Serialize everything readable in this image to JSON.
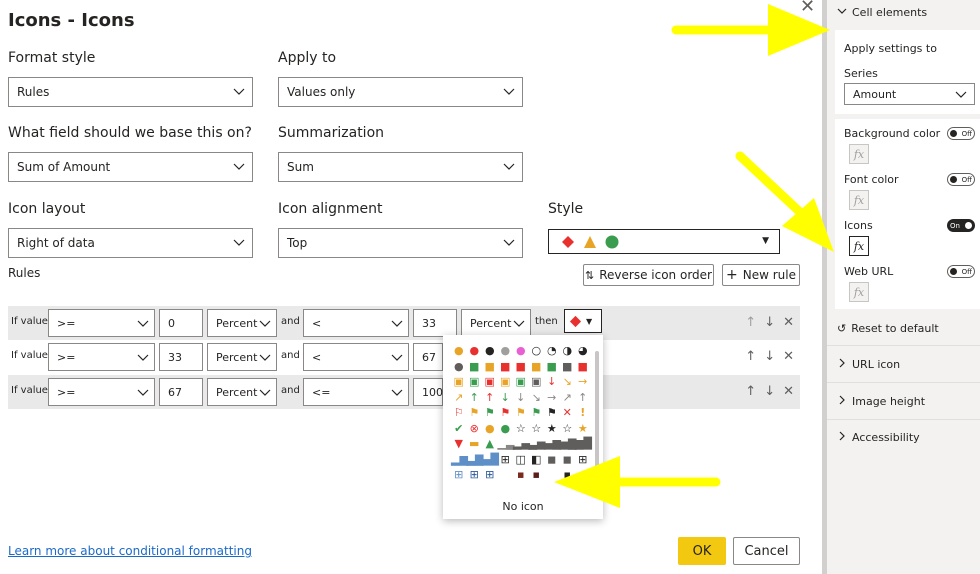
{
  "dialog": {
    "title": "Icons - Icons",
    "format_style_label": "Format style",
    "format_style_value": "Rules",
    "apply_to_label": "Apply to",
    "apply_to_value": "Values only",
    "base_field_label": "What field should we base this on?",
    "base_field_value": "Sum of Amount",
    "summarization_label": "Summarization",
    "summarization_value": "Sum",
    "icon_layout_label": "Icon layout",
    "icon_layout_value": "Right of data",
    "icon_alignment_label": "Icon alignment",
    "icon_alignment_value": "Top",
    "style_label": "Style",
    "rules_label": "Rules",
    "reverse_label": "Reverse icon order",
    "new_rule_label": "New rule",
    "learn_more": "Learn more about conditional formatting",
    "ok_label": "OK",
    "cancel_label": "Cancel"
  },
  "rules": [
    {
      "if": "If value",
      "op1": ">=",
      "v1": "0",
      "u1": "Percent",
      "and": "and",
      "op2": "<",
      "v2": "33",
      "u2": "Percent",
      "then": "then"
    },
    {
      "if": "If value",
      "op1": ">=",
      "v1": "33",
      "u1": "Percent",
      "and": "and",
      "op2": "<",
      "v2": "67"
    },
    {
      "if": "If value",
      "op1": ">=",
      "v1": "67",
      "u1": "Percent",
      "and": "and",
      "op2": "<=",
      "v2": "100"
    }
  ],
  "popup": {
    "no_icon_label": "No icon"
  },
  "pane": {
    "cell_elements": "Cell elements",
    "apply_settings_to": "Apply settings to",
    "series_label": "Series",
    "series_value": "Amount",
    "background_color": "Background color",
    "font_color": "Font color",
    "icons": "Icons",
    "web_url": "Web URL",
    "off": "Off",
    "on": "On",
    "fx": "fx",
    "reset": "Reset to default",
    "url_icon": "URL icon",
    "image_height": "Image height",
    "accessibility": "Accessibility"
  },
  "colors": {
    "accent_yellow": "#f2c811",
    "arrow_yellow": "#ffff00",
    "red": "#e8312f",
    "orange": "#e8a427",
    "green": "#3a9c4e"
  }
}
